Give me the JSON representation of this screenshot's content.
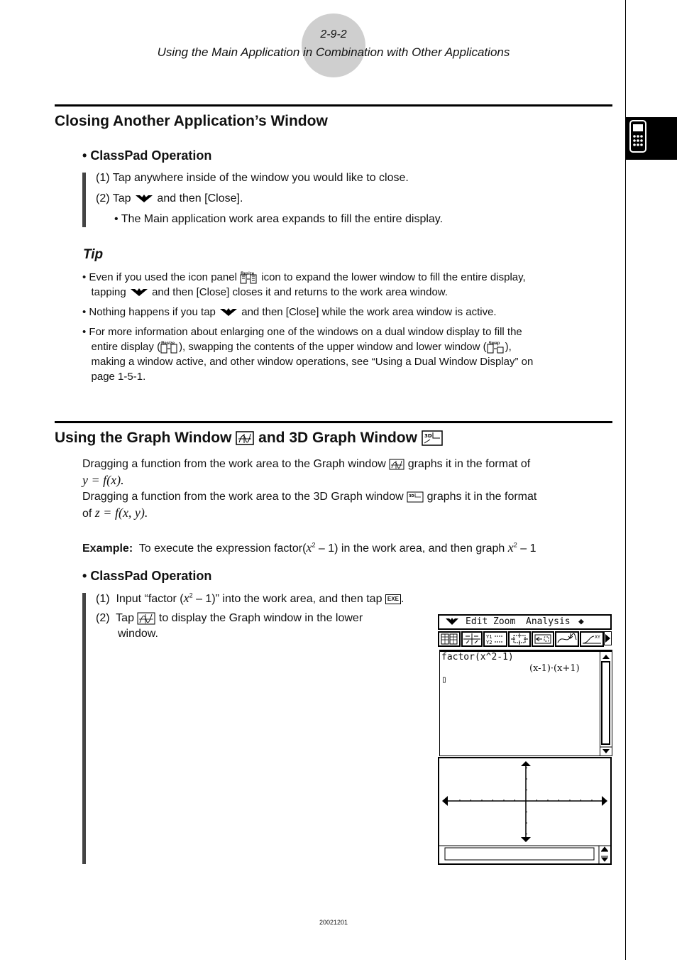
{
  "header": {
    "page_number": "2-9-2",
    "chapter_title": "Using the Main Application in Combination with Other Applications"
  },
  "side_tab": {
    "icon": "calculator-icon"
  },
  "section1": {
    "title": "Closing Another Application’s Window",
    "operation_heading": "ClassPad Operation",
    "steps": [
      {
        "num": "(1)",
        "text": "Tap anywhere inside of the window you would like to close."
      },
      {
        "num": "(2)",
        "pre": "Tap",
        "icon": "menu-chevron-icon",
        "post": "and then [Close]."
      }
    ],
    "step_note": "The Main application work area expands to fill the entire display.",
    "tip": {
      "title": "Tip",
      "items": [
        {
          "part1": "Even if you used the icon panel",
          "icon1": "resize-icon",
          "part2": "icon to expand the lower window to fill the entire display,",
          "part3": "tapping",
          "icon2": "menu-chevron-icon",
          "part4": "and then [Close] closes it and returns to the work area window."
        },
        {
          "part1": "Nothing happens if you tap",
          "icon1": "menu-chevron-icon",
          "part2": "and then [Close] while the work area window is active."
        },
        {
          "line1": "For more information about enlarging one of the windows on a dual window display to fill the",
          "line2a": "entire display (",
          "icon1": "resize-icon",
          "line2b": "), swapping the contents of the upper window and lower window (",
          "icon2": "swap-icon",
          "line2c": "),",
          "line3": "making a window active, and other window operations, see “Using a Dual Window Display” on",
          "line4": "page 1-5-1."
        }
      ],
      "icon_labels": {
        "resize": "Resize",
        "swap": "Swap"
      }
    }
  },
  "section2": {
    "title_part1": "Using the Graph Window",
    "title_part2": "and 3D Graph Window",
    "para1_a": "Dragging a function from the work area to the Graph window",
    "para1_b": "graphs it in the format of",
    "para1_formula": "y = f(x).",
    "para2_a": "Dragging a function from the work area to the 3D Graph window",
    "para2_b": "graphs it in the format",
    "para2_c": "of",
    "para2_formula": "z = f(x, y).",
    "example_label": "Example:",
    "example_text_a": "To execute the expression factor(",
    "example_x": "x",
    "example_sup": "2",
    "example_text_b": "– 1) in the work area, and then graph",
    "example_text_c": "– 1",
    "operation_heading": "ClassPad Operation",
    "steps": [
      {
        "num": "(1)",
        "text_a": "Input “factor (",
        "x": "x",
        "sup": "2",
        "text_b": "– 1)” into the work area, and then tap",
        "key": "EXE",
        "end": "."
      },
      {
        "num": "(2)",
        "pre": "Tap",
        "post": "to display the Graph window in the lower",
        "line2": "window."
      }
    ]
  },
  "calculator_screen": {
    "menu_bar": {
      "chevron": "menu-chevron-icon",
      "items": [
        "Edit",
        "Zoom",
        "Analysis"
      ],
      "extra": "◆"
    },
    "toolbar_icons": [
      "table-icon",
      "trace-icon",
      "y-list-icon",
      "zoom-box-icon",
      "zoom-in-icon",
      "graph-adjust-icon",
      "sketch-icon",
      "more-arrow-icon"
    ],
    "work_area": {
      "input_line": "factor(x^2-1)",
      "result_line": "(x-1)·(x+1)",
      "cursor": "▯"
    },
    "graph_window": {
      "x_axis_ticks": 12,
      "y_axis_ticks": 6
    }
  },
  "footer": {
    "code": "20021201"
  }
}
